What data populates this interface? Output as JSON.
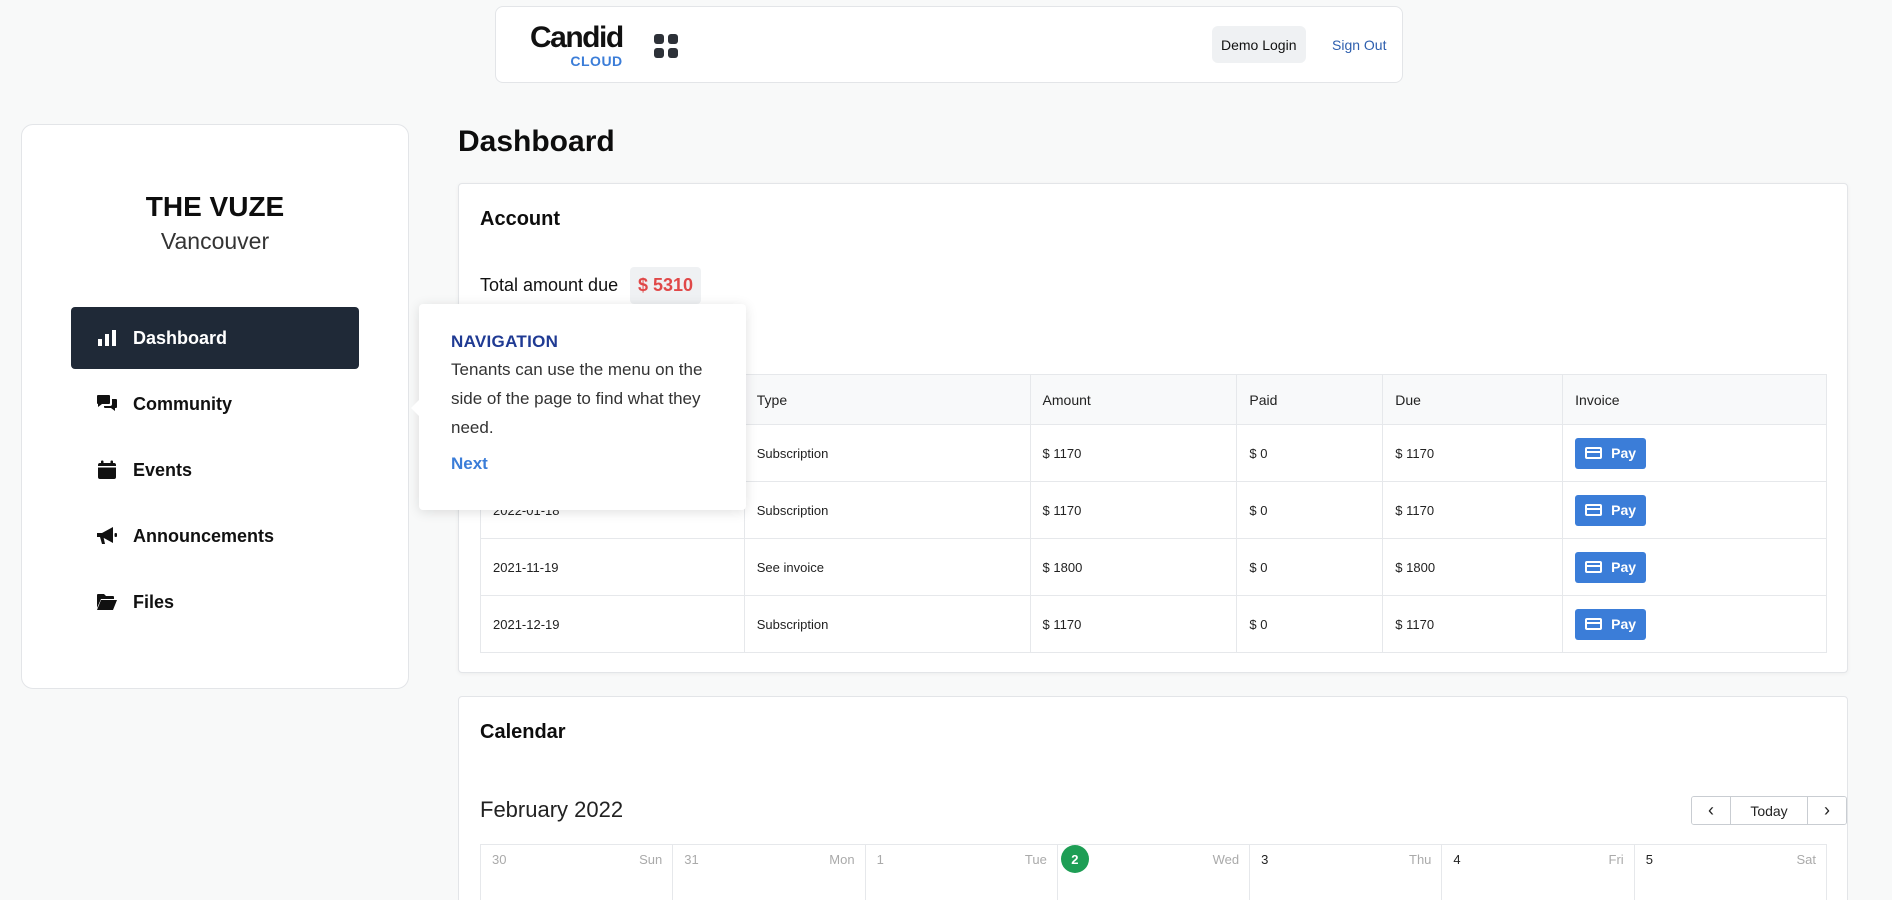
{
  "header": {
    "logo_main": "Candid",
    "logo_sub": "CLOUD",
    "apps_icon": "grid-apps-icon",
    "demo_login_label": "Demo Login",
    "sign_out_label": "Sign Out"
  },
  "sidebar": {
    "property_name": "THE VUZE",
    "property_city": "Vancouver",
    "items": [
      {
        "label": "Dashboard",
        "icon": "bar-chart-icon",
        "active": true
      },
      {
        "label": "Community",
        "icon": "chat-bubbles-icon",
        "active": false
      },
      {
        "label": "Events",
        "icon": "calendar-icon",
        "active": false
      },
      {
        "label": "Announcements",
        "icon": "megaphone-icon",
        "active": false
      },
      {
        "label": "Files",
        "icon": "folder-open-icon",
        "active": false
      }
    ]
  },
  "main": {
    "title": "Dashboard",
    "account": {
      "title": "Account",
      "total_label": "Total amount due",
      "total_value": "$ 5310",
      "columns": [
        "Type",
        "Amount",
        "Paid",
        "Due",
        "Invoice"
      ],
      "rows": [
        {
          "date": "",
          "type": "Subscription",
          "amount": "$ 1170",
          "paid": "$ 0",
          "due": "$ 1170",
          "action": "Pay"
        },
        {
          "date": "2022-01-18",
          "type": "Subscription",
          "amount": "$ 1170",
          "paid": "$ 0",
          "due": "$ 1170",
          "action": "Pay"
        },
        {
          "date": "2021-11-19",
          "type": "See invoice",
          "amount": "$ 1800",
          "paid": "$ 0",
          "due": "$ 1800",
          "action": "Pay"
        },
        {
          "date": "2021-12-19",
          "type": "Subscription",
          "amount": "$ 1170",
          "paid": "$ 0",
          "due": "$ 1170",
          "action": "Pay"
        }
      ]
    },
    "calendar": {
      "title": "Calendar",
      "month": "February 2022",
      "prev_label": "‹",
      "today_label": "Today",
      "next_label": "›",
      "days": [
        {
          "num": "30",
          "dow": "Sun",
          "past": true
        },
        {
          "num": "31",
          "dow": "Mon",
          "past": true
        },
        {
          "num": "1",
          "dow": "Tue",
          "past": true
        },
        {
          "num": "2",
          "dow": "Wed",
          "today": true
        },
        {
          "num": "3",
          "dow": "Thu"
        },
        {
          "num": "4",
          "dow": "Fri"
        },
        {
          "num": "5",
          "dow": "Sat"
        }
      ]
    }
  },
  "tooltip": {
    "title": "NAVIGATION",
    "body": "Tenants can use the menu on the side of the page to find what they need.",
    "next_label": "Next"
  },
  "colors": {
    "accent": "#3b7dd8",
    "active_nav": "#1f2937",
    "due_amount": "#e04848",
    "today_marker": "#1e9e55",
    "tooltip_title": "#1f3a93"
  }
}
